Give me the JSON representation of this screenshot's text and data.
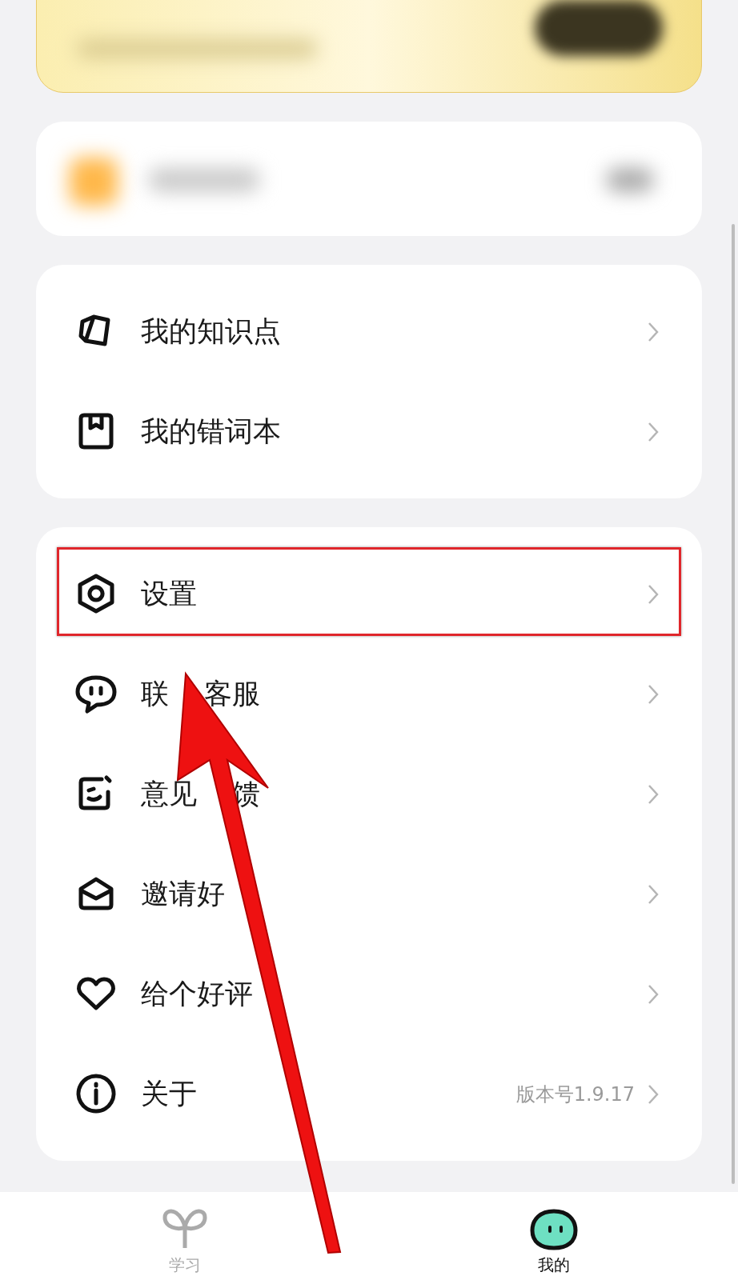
{
  "menu_groups": [
    {
      "items": [
        {
          "label": "我的知识点"
        },
        {
          "label": "我的错词本"
        }
      ]
    },
    {
      "items": [
        {
          "label": "设置"
        },
        {
          "segments": [
            "联",
            "客服"
          ]
        },
        {
          "segments": [
            "意见",
            "馈"
          ]
        },
        {
          "segments": [
            "邀请好"
          ]
        },
        {
          "label": "给个好评"
        },
        {
          "label": "关于",
          "value": "版本号1.9.17"
        }
      ]
    }
  ],
  "tabs": [
    {
      "label": "学习",
      "selected": false
    },
    {
      "label": "我的",
      "selected": true
    }
  ]
}
